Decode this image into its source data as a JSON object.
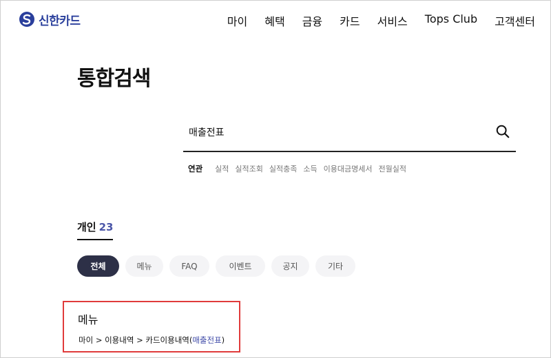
{
  "header": {
    "logo_text": "신한카드",
    "logo_icon": "shinhan-logo-icon",
    "nav": [
      "마이",
      "혜택",
      "금융",
      "카드",
      "서비스",
      "Tops Club",
      "고객센터"
    ]
  },
  "page_title": "통합검색",
  "search": {
    "value": "매출전표",
    "icon": "search-icon"
  },
  "related": {
    "label": "연관",
    "items": [
      "실적",
      "실적조회",
      "실적충족",
      "소득",
      "이용대금명세서",
      "전월실적"
    ]
  },
  "tab": {
    "label": "개인",
    "count": "23"
  },
  "filters": [
    "전체",
    "메뉴",
    "FAQ",
    "이벤트",
    "공지",
    "기타"
  ],
  "active_filter": "전체",
  "result": {
    "title": "메뉴",
    "path_prefix": "마이 > 이용내역 > 카드이용내역(",
    "path_highlight": "매출전표",
    "path_suffix": ")"
  },
  "colors": {
    "brand": "#2a3f9c",
    "accent": "#4b56a8",
    "active_chip": "#2d3047",
    "highlight_border": "#e03a3a"
  }
}
